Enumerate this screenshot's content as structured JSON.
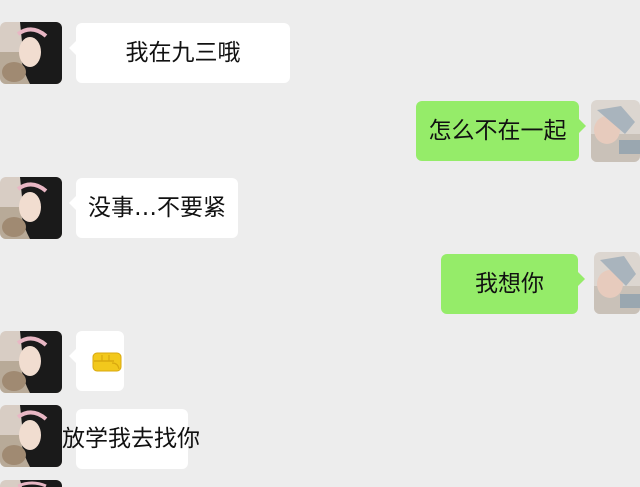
{
  "messages": [
    {
      "side": "left",
      "text": "我在九三哦"
    },
    {
      "side": "right",
      "text": "怎么不在一起"
    },
    {
      "side": "left",
      "text": "没事…不要紧"
    },
    {
      "side": "right",
      "text": "我想你"
    },
    {
      "side": "left",
      "emoji": "fist-emoji",
      "text": ""
    },
    {
      "side": "left",
      "text": "放学我去找你"
    }
  ],
  "colors": {
    "background": "#ededed",
    "incoming_bubble": "#ffffff",
    "outgoing_bubble": "#95ec69",
    "emoji_fill": "#f2c81c"
  }
}
